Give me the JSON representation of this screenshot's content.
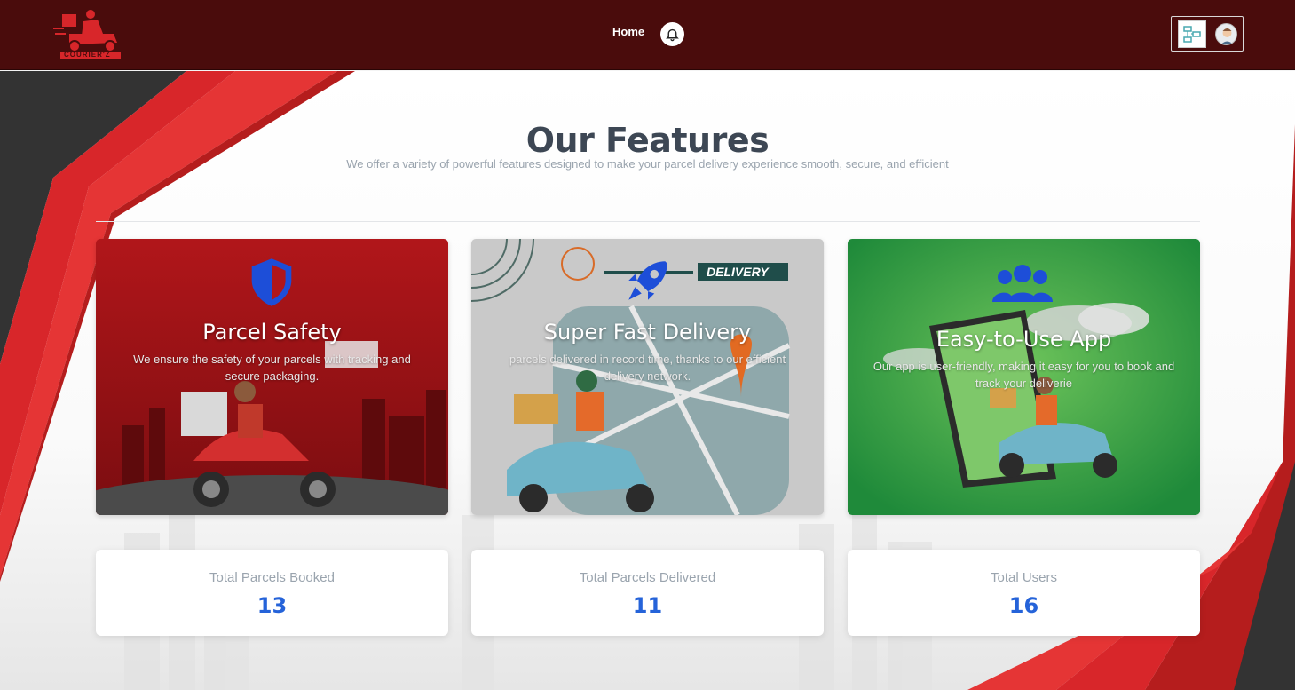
{
  "header": {
    "logo_text": "COURIER'Z",
    "nav_home": "Home",
    "bell_icon": "bell-icon",
    "user_thumbnail_icon": "diagram-icon",
    "avatar_icon": "user-avatar-icon"
  },
  "features": {
    "title": "Our Features",
    "subtitle": "We offer a variety of powerful features designed to make your parcel delivery experience smooth, secure, and efficient",
    "cards": [
      {
        "icon": "shield-icon",
        "title": "Parcel Safety",
        "description": "We ensure the safety of your parcels with tracking and secure packaging."
      },
      {
        "icon": "rocket-icon",
        "badge": "DELIVERY",
        "title": "Super Fast Delivery",
        "description": "parcels delivered in record time, thanks to our efficient delivery network."
      },
      {
        "icon": "users-icon",
        "title": "Easy-to-Use App",
        "description": "Our app is user-friendly, making it easy for you to book and track your deliverie"
      }
    ]
  },
  "stats": [
    {
      "label": "Total Parcels Booked",
      "value": "13"
    },
    {
      "label": "Total Parcels Delivered",
      "value": "11"
    },
    {
      "label": "Total Users",
      "value": "16"
    }
  ],
  "colors": {
    "navbar": "#4a0c0c",
    "accent_red": "#d8262a",
    "stat_value": "#2563d9",
    "card_green": "#1f8a3a"
  }
}
